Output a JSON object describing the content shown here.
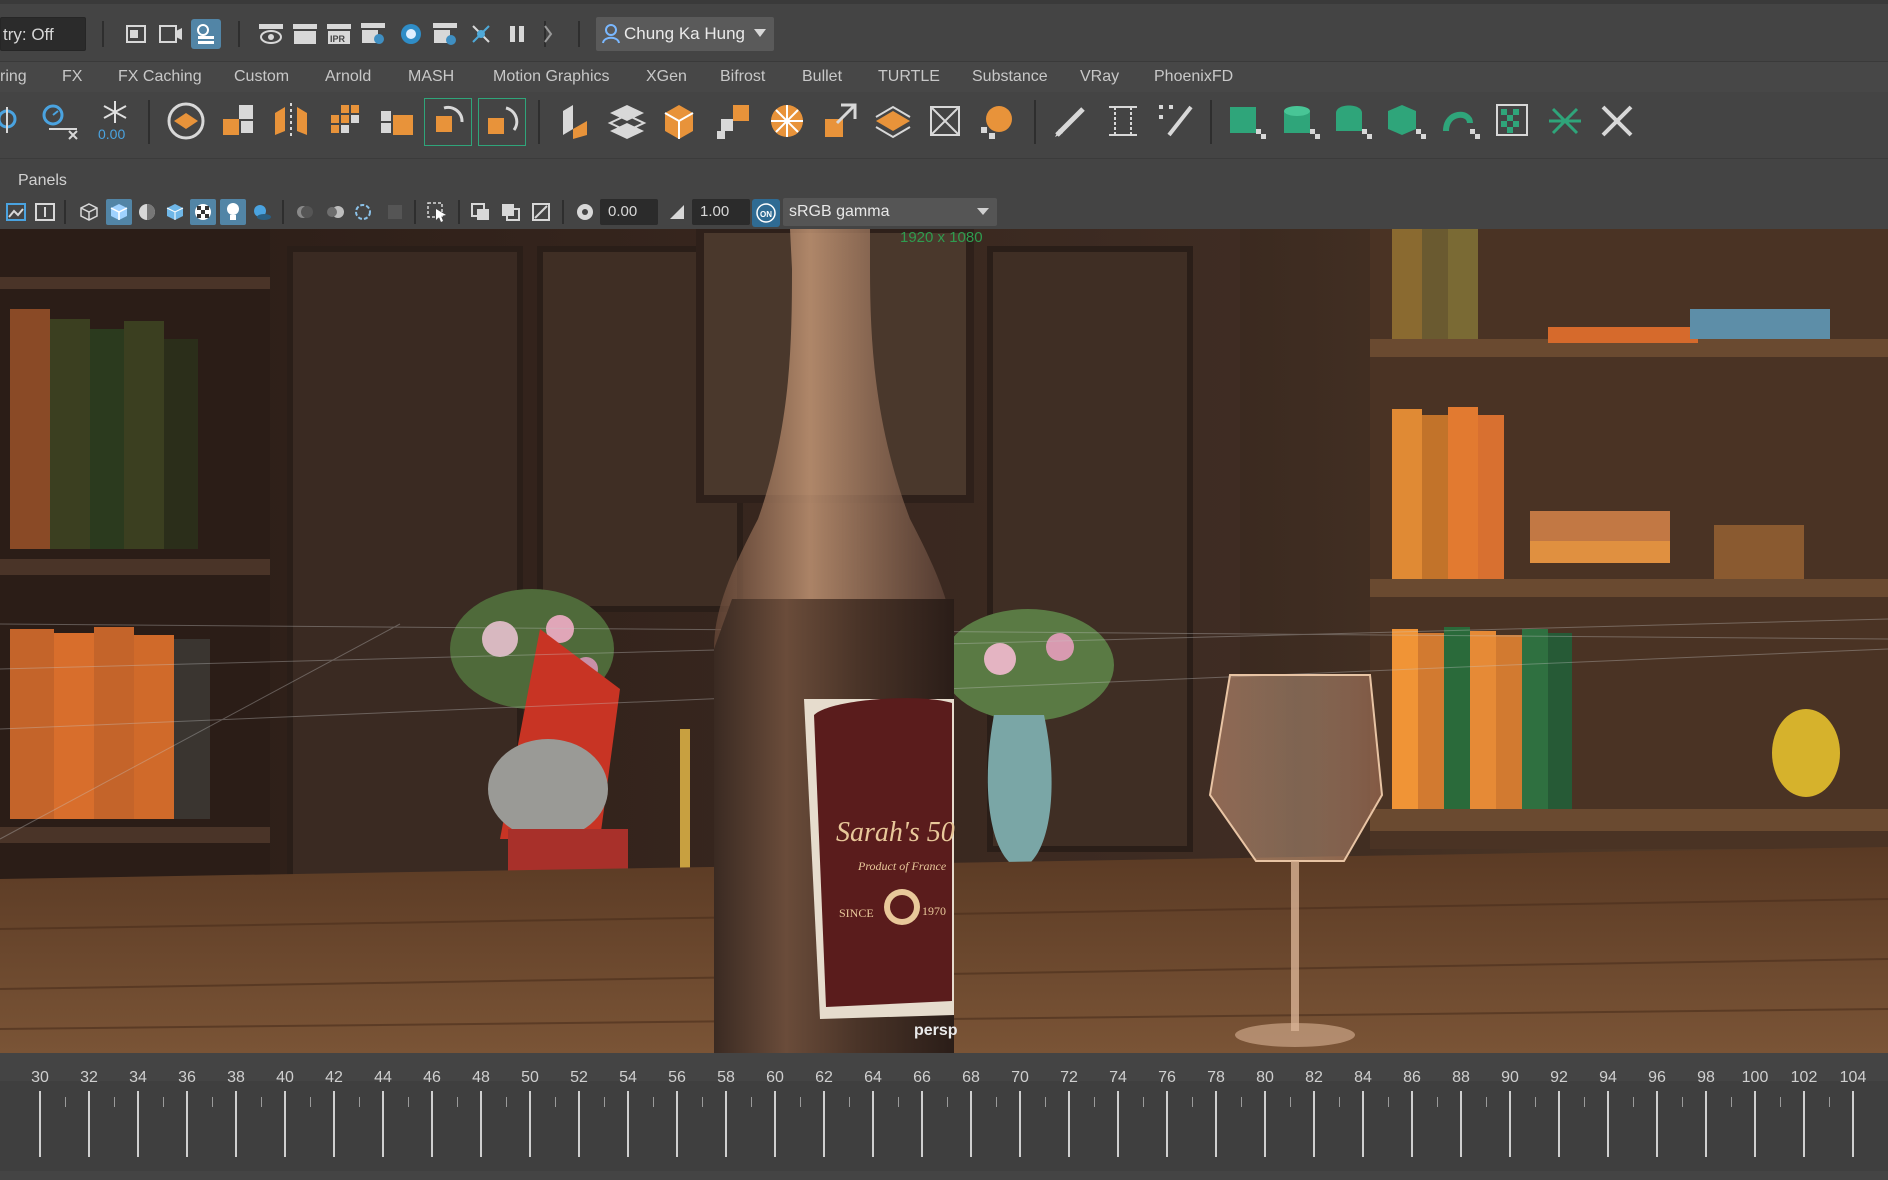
{
  "status_line": {
    "symmetry_text": "try: Off",
    "user_name": "Chung Ka Hung"
  },
  "shelf_tabs": [
    "ring",
    "FX",
    "FX Caching",
    "Custom",
    "Arnold",
    "MASH",
    "Motion Graphics",
    "XGen",
    "Bifrost",
    "Bullet",
    "TURTLE",
    "Substance",
    "VRay",
    "PhoenixFD"
  ],
  "shelf_icon_value": "0.00",
  "panel": {
    "menu": "Panels",
    "exposure": "0.00",
    "gamma": "1.00",
    "color_management_toggle": "ON",
    "view_transform": "sRGB gamma"
  },
  "viewport": {
    "resolution": "1920 x 1080",
    "camera": "persp",
    "label_brand": "Sarah's 50",
    "label_sub": "Product of France",
    "label_since": "SINCE",
    "label_year": "1970"
  },
  "timeline": {
    "ticks": [
      "30",
      "32",
      "34",
      "36",
      "38",
      "40",
      "42",
      "44",
      "46",
      "48",
      "50",
      "52",
      "54",
      "56",
      "58",
      "60",
      "62",
      "64",
      "66",
      "68",
      "70",
      "72",
      "74",
      "76",
      "78",
      "80",
      "82",
      "84",
      "86",
      "88",
      "90",
      "92",
      "94",
      "96",
      "98",
      "100",
      "102",
      "104"
    ]
  },
  "colors": {
    "ui_background": "#444444",
    "active_icon": "#5285a6",
    "resolution_text": "#2f9c4f",
    "shelf_green": "#2fa57a",
    "shelf_orange": "#e8933a"
  }
}
